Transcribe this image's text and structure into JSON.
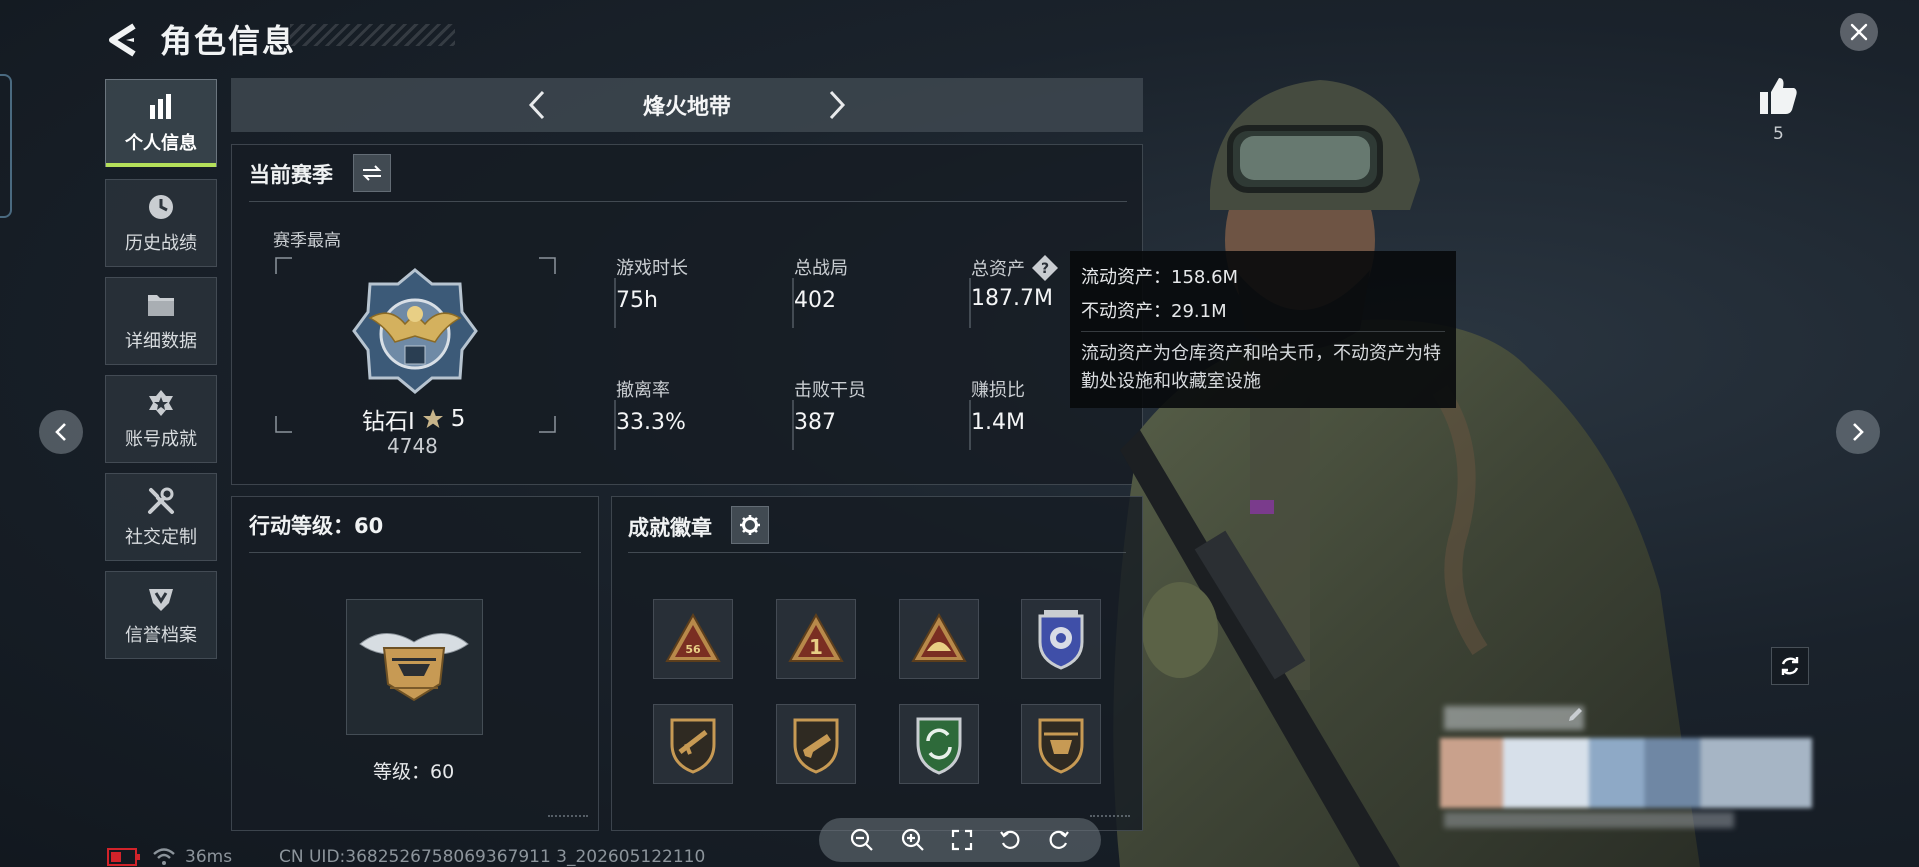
{
  "header": {
    "title": "角色信息"
  },
  "sidebar": {
    "items": [
      {
        "label": "个人信息",
        "icon": "bar-chart-icon",
        "active": true
      },
      {
        "label": "历史战绩",
        "icon": "history-clock-icon",
        "active": false
      },
      {
        "label": "详细数据",
        "icon": "folder-icon",
        "active": false
      },
      {
        "label": "账号成就",
        "icon": "achievement-icon",
        "active": false
      },
      {
        "label": "社交定制",
        "icon": "tools-icon",
        "active": false
      },
      {
        "label": "信誉档案",
        "icon": "credit-shield-icon",
        "active": false
      }
    ]
  },
  "mode": {
    "title": "烽火地带"
  },
  "season": {
    "title": "当前赛季",
    "best_label": "赛季最高",
    "rank_name": "钻石I",
    "rank_stars": "5",
    "rank_score": "4748",
    "stats": [
      {
        "label": "游戏时长",
        "value": "75h"
      },
      {
        "label": "总战局",
        "value": "402"
      },
      {
        "label": "总资产",
        "value": "187.7M"
      },
      {
        "label": "撤离率",
        "value": "33.3%"
      },
      {
        "label": "击败干员",
        "value": "387"
      },
      {
        "label": "赚损比",
        "value": "1.4M"
      }
    ]
  },
  "tooltip": {
    "line1": "流动资产：158.6M",
    "line2": "不动资产：29.1M",
    "description": "流动资产为仓库资产和哈夫币，不动资产为特勤处设施和收藏室设施"
  },
  "action_level": {
    "title": "行动等级：60",
    "level_text": "等级：60"
  },
  "badges": {
    "title": "成就徽章",
    "items": [
      "triangle-56-badge",
      "triangle-number-one-badge",
      "triangle-helmet-badge",
      "blue-shield-emblem-badge",
      "gold-shield-rifle-badge",
      "gold-shield-pistol-badge",
      "green-shield-arrows-badge",
      "gold-shield-helicopter-badge"
    ]
  },
  "likes": {
    "count": "5"
  },
  "status": {
    "ping": "36ms",
    "uid": "CN UID:3682526758069367911 3_202605122110"
  },
  "colors": {
    "accent": "#b5e05a",
    "tooltip_bg": "#0a0c0e",
    "panel_bg": "#161c23"
  }
}
